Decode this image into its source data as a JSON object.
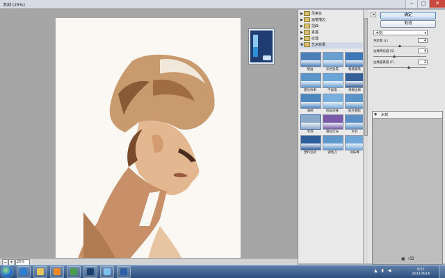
{
  "window": {
    "title": "木刻 (25%)",
    "controls": [
      "─",
      "□",
      "✕"
    ]
  },
  "preview": {
    "zoom_value": "25%",
    "zoom_out": "−",
    "zoom_in": "+"
  },
  "gallery": {
    "folders": [
      {
        "label": "风格化",
        "open": false
      },
      {
        "label": "画笔描边",
        "open": false
      },
      {
        "label": "扭曲",
        "open": false
      },
      {
        "label": "素描",
        "open": false
      },
      {
        "label": "纹理",
        "open": false
      },
      {
        "label": "艺术效果",
        "open": true
      }
    ],
    "filters": [
      {
        "label": "壁画",
        "color": "#4a7fb8"
      },
      {
        "label": "彩色铅笔",
        "color": "#6aa0d0"
      },
      {
        "label": "粗糙蜡笔",
        "color": "#3f78b8"
      },
      {
        "label": "底纹效果",
        "color": "#5c95c9"
      },
      {
        "label": "干画笔",
        "color": "#6ba4d6"
      },
      {
        "label": "海报边缘",
        "color": "#355f99"
      },
      {
        "label": "海绵",
        "color": "#4d86bd"
      },
      {
        "label": "绘画涂抹",
        "color": "#78aedc"
      },
      {
        "label": "胶片颗粒",
        "color": "#5a93c7"
      },
      {
        "label": "木刻",
        "color": "#8aa9c8"
      },
      {
        "label": "霓虹灯光",
        "color": "#7a5aa8"
      },
      {
        "label": "水彩",
        "color": "#5b8fc4"
      },
      {
        "label": "塑料包装",
        "color": "#2f5f9a"
      },
      {
        "label": "调色刀",
        "color": "#5e97cb"
      },
      {
        "label": "涂抹棒",
        "color": "#6fa7d8"
      }
    ],
    "selected_filter": "木刻"
  },
  "settings": {
    "ok_label": "确定",
    "cancel_label": "取消",
    "filter_name": "木刻",
    "params": [
      {
        "label": "色阶数 (L)",
        "value": "4",
        "level": 0.5
      },
      {
        "label": "边缘简化度 (S)",
        "value": "4",
        "level": 0.4
      },
      {
        "label": "边缘逼真度 (F)",
        "value": "2",
        "level": 0.67
      }
    ],
    "layer_name": "木刻"
  },
  "taskbar": {
    "apps": [
      {
        "name": "ie-icon",
        "color": "#2a7fd4"
      },
      {
        "name": "folder-icon",
        "color": "#e8c35a"
      },
      {
        "name": "media-player-icon",
        "color": "#f08a24"
      },
      {
        "name": "paint-icon",
        "color": "#4a9e4a"
      },
      {
        "name": "photoshop-icon",
        "color": "#1a3d6e"
      },
      {
        "name": "qq-icon",
        "color": "#7fc3f0"
      },
      {
        "name": "word-icon",
        "color": "#2b5fa8"
      }
    ],
    "time": "9:51",
    "date": "2011/9/14"
  }
}
